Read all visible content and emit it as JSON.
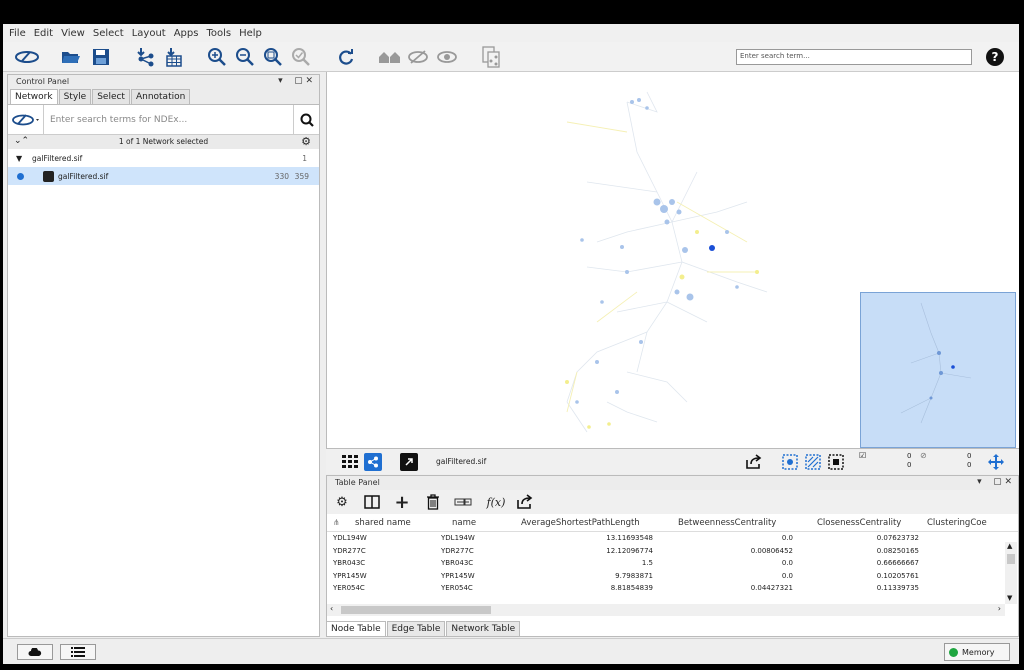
{
  "menu": [
    "File",
    "Edit",
    "View",
    "Select",
    "Layout",
    "Apps",
    "Tools",
    "Help"
  ],
  "toolbar": {
    "search_placeholder": "Enter search term...",
    "help_label": "?"
  },
  "control_panel": {
    "title": "Control Panel",
    "tabs": [
      "Network",
      "Style",
      "Select",
      "Annotation"
    ],
    "ndex_placeholder": "Enter search terms for NDEx...",
    "summary": "1 of 1 Network selected",
    "collection": {
      "name": "galFiltered.sif",
      "count": "1"
    },
    "network": {
      "name": "galFiltered.sif",
      "nodes": "330",
      "edges": "359"
    }
  },
  "network_view": {
    "name": "galFiltered.sif",
    "sel_nodes": "0",
    "sel_nodes2": "0",
    "hidden_nodes": "0",
    "hidden_nodes2": "0"
  },
  "table_panel": {
    "title": "Table Panel",
    "columns": [
      "shared name",
      "name",
      "AverageShortestPathLength",
      "BetweennessCentrality",
      "ClosenessCentrality",
      "ClusteringCoe"
    ],
    "rows": [
      [
        "YDL194W",
        "YDL194W",
        "13.11693548",
        "0.0",
        "0.07623732"
      ],
      [
        "YDR277C",
        "YDR277C",
        "12.12096774",
        "0.00806452",
        "0.08250165"
      ],
      [
        "YBR043C",
        "YBR043C",
        "1.5",
        "0.0",
        "0.66666667"
      ],
      [
        "YPR145W",
        "YPR145W",
        "9.7983871",
        "0.0",
        "0.10205761"
      ],
      [
        "YER054C",
        "YER054C",
        "8.81854839",
        "0.04427321",
        "0.11339735"
      ]
    ],
    "bottom_tabs": [
      "Node Table",
      "Edge Table",
      "Network Table"
    ]
  },
  "status": {
    "memory_label": "Memory"
  }
}
